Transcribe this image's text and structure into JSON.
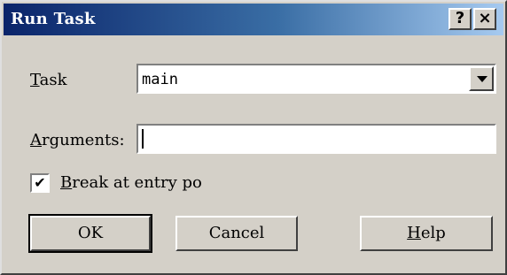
{
  "window": {
    "title": "Run Task",
    "help_button": "?",
    "close_button": "×"
  },
  "task": {
    "label_first": "T",
    "label_rest": "ask",
    "selected_value": "main"
  },
  "arguments": {
    "label_first": "A",
    "label_rest": "rguments:",
    "value": ""
  },
  "break_option": {
    "checked": true,
    "check_glyph": "✔",
    "label_first": "B",
    "label_rest": "reak at entry po"
  },
  "buttons": {
    "ok": "OK",
    "cancel": "Cancel",
    "help_first": "H",
    "help_rest": "elp"
  }
}
